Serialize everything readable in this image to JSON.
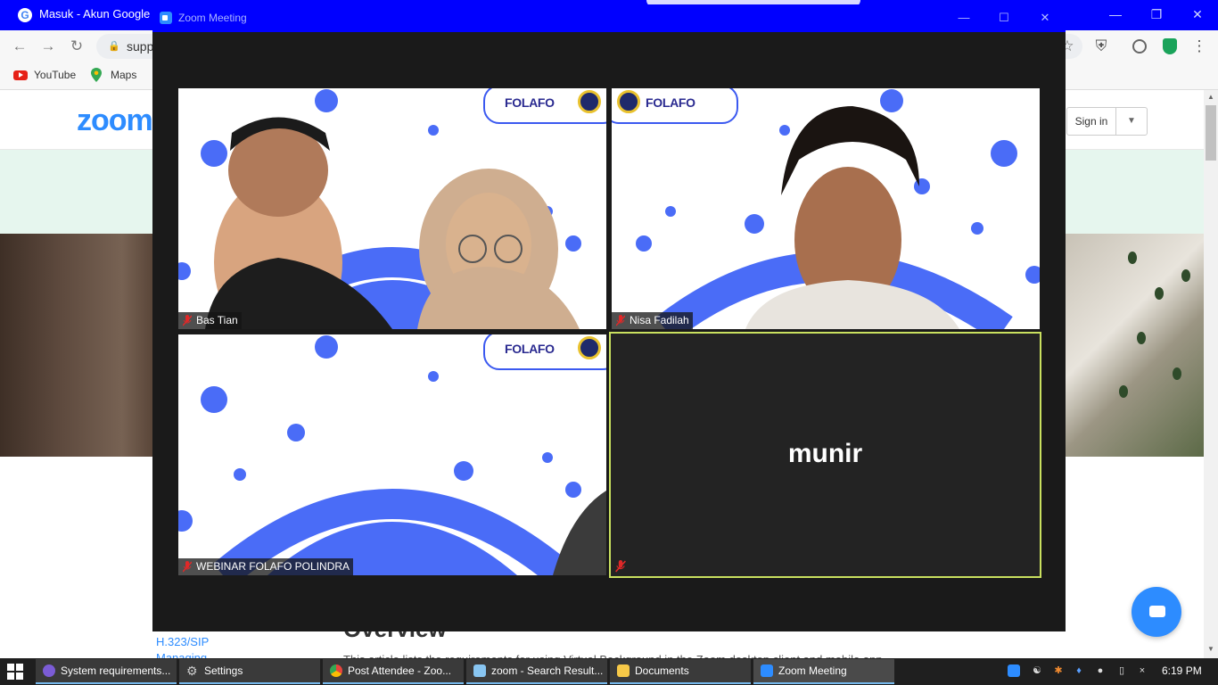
{
  "browser": {
    "tab_title": "Masuk - Akun Google",
    "url_visible": "supp",
    "bookmarks": [
      {
        "label": "YouTube",
        "icon": "youtube-icon"
      },
      {
        "label": "Maps",
        "icon": "maps-icon"
      }
    ]
  },
  "page": {
    "logo": "zoom",
    "signin_label": "Sign in",
    "sidebar_links": [
      "H.323/SIP",
      "Managing"
    ],
    "heading": "Overview",
    "body_snippet": "This article lists the requirements for using Virtual Background in the Zoom desktop client and mobile app."
  },
  "zoom_window": {
    "title": "Zoom Meeting",
    "participants": [
      {
        "name": "Bas Tian",
        "muted": true,
        "video": true
      },
      {
        "name": "Nisa Fadilah",
        "muted": true,
        "video": true
      },
      {
        "name": "WEBINAR FOLAFO POLINDRA",
        "muted": true,
        "video": true
      },
      {
        "name": "munir",
        "muted": true,
        "video": false,
        "active_speaker": true
      }
    ],
    "badge_text": "FOLAFO"
  },
  "taskbar": {
    "items": [
      {
        "label": "System requirements...",
        "icon": "browser-icon",
        "color": "#7b5cd6"
      },
      {
        "label": "Settings",
        "icon": "gear-icon",
        "color": "#9aa0a6"
      },
      {
        "label": "Post Attendee - Zoo...",
        "icon": "chrome-icon",
        "color": "#e8453c"
      },
      {
        "label": "zoom - Search Result...",
        "icon": "document-icon",
        "color": "#88c5f1"
      },
      {
        "label": "Documents",
        "icon": "folder-icon",
        "color": "#f7c948"
      },
      {
        "label": "Zoom Meeting",
        "icon": "zoom-icon",
        "color": "#2d8cff"
      }
    ],
    "clock": "6:19 PM"
  },
  "colors": {
    "accent": "#2d8cff",
    "titlebar": "#0000ff",
    "active_speaker_border": "#c9e05f",
    "background_blue": "#4a6cf7"
  }
}
